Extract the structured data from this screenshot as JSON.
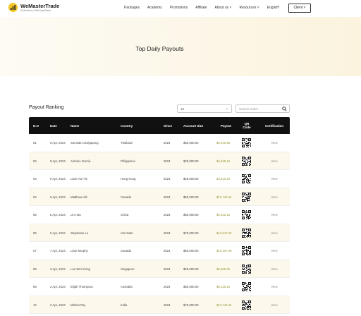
{
  "header": {
    "brand": "WeMasterTrade",
    "tagline": "A Member of WeCopyTrade",
    "nav": [
      "Packages",
      "Academy",
      "Promotions",
      "Affiliate",
      "About us ˅",
      "Resources ˅",
      "EnglisH"
    ],
    "client_label": "Client ˅"
  },
  "hero": {
    "title": "Top Daily Payouts"
  },
  "ranking": {
    "title": "Payout Ranking",
    "select_value": "10",
    "search_placeholder": "Search trader"
  },
  "table": {
    "columns": [
      "N.O",
      "Date",
      "Name",
      "Country",
      "Since",
      "Account Size",
      "Payout",
      "QR Code",
      "Certification"
    ],
    "rows": [
      {
        "no": "01",
        "date": "9 Apr, 2024",
        "name": "Somsak Chaiyapong",
        "country": "Thailand",
        "since": "2024",
        "size": "$50,000.00",
        "payout": "$6,240.55",
        "cert": "View"
      },
      {
        "no": "02",
        "date": "9 Apr, 2024",
        "name": "Antonio Garcia",
        "country": "Philippines",
        "since": "2024",
        "size": "$25,000.00",
        "payout": "$4,465.15",
        "cert": "View"
      },
      {
        "no": "03",
        "date": "9 Apr, 2024",
        "name": "Liam Hui Yin",
        "country": "Hong Kong",
        "since": "2024",
        "size": "$25,000.00",
        "payout": "$4,810.20",
        "cert": "View"
      },
      {
        "no": "04",
        "date": "6 Apr, 2024",
        "name": "Matthew Hill",
        "country": "Canada",
        "since": "2024",
        "size": "$50,000.00",
        "payout": "$10,740.44",
        "cert": "View"
      },
      {
        "no": "05",
        "date": "5 Apr, 2024",
        "name": "Lin Hao",
        "country": "China",
        "since": "2024",
        "size": "$50,000.00",
        "payout": "$9,222.15",
        "cert": "View"
      },
      {
        "no": "06",
        "date": "5 Apr, 2024",
        "name": "Stephanie Le",
        "country": "Viet Nam",
        "since": "2024",
        "size": "$75,000.00",
        "payout": "$12,547.55",
        "cert": "View"
      },
      {
        "no": "07",
        "date": "7 Apr, 2024",
        "name": "Liam Murphy",
        "country": "Canada",
        "since": "2024",
        "size": "$50,000.00",
        "payout": "$10,207.90",
        "cert": "View"
      },
      {
        "no": "08",
        "date": "3 Apr, 2024",
        "name": "Lee Wei Xiong",
        "country": "Singapore",
        "since": "2024",
        "size": "$25,000.00",
        "payout": "$6,585.55",
        "cert": "View"
      },
      {
        "no": "09",
        "date": "2 Apr, 2024",
        "name": "Elijah Thompson",
        "country": "Australia",
        "since": "2024",
        "size": "$50,000.00",
        "payout": "$9,125.10",
        "cert": "View"
      },
      {
        "no": "10",
        "date": "2 Apr, 2024",
        "name": "Mishra Raj",
        "country": "India",
        "since": "2024",
        "size": "$75,000.00",
        "payout": "$12,749.44",
        "cert": "View"
      }
    ]
  },
  "colors": {
    "accent": "#f3c623",
    "header_bg": "#111111",
    "row_alt": "#fdf8ec",
    "payout_text": "#9a9a3a"
  },
  "icons": {
    "logo": "chart-bars-icon",
    "search": "search-icon",
    "dropdown": "chevron-down-icon",
    "qr": "qr-code-icon"
  }
}
